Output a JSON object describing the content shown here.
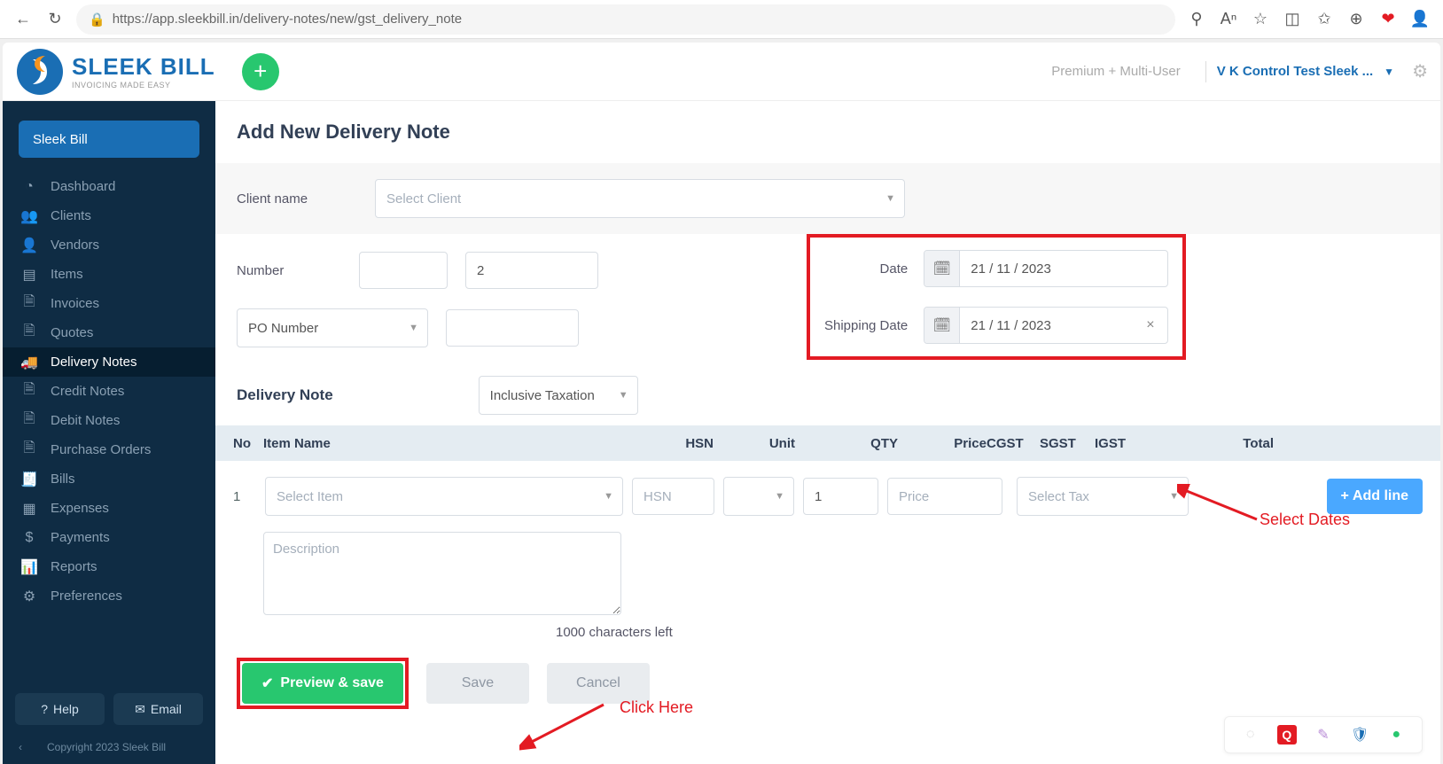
{
  "browser": {
    "url": "https://app.sleekbill.in/delivery-notes/new/gst_delivery_note"
  },
  "header": {
    "logo_title": "SLEEK BILL",
    "logo_sub": "INVOICING MADE EASY",
    "premium": "Premium + Multi-User",
    "username": "V K Control Test Sleek ..."
  },
  "sidebar": {
    "brand": "Sleek Bill",
    "items": [
      {
        "label": "Dashboard"
      },
      {
        "label": "Clients"
      },
      {
        "label": "Vendors"
      },
      {
        "label": "Items"
      },
      {
        "label": "Invoices"
      },
      {
        "label": "Quotes"
      },
      {
        "label": "Delivery Notes",
        "active": true
      },
      {
        "label": "Credit Notes"
      },
      {
        "label": "Debit Notes"
      },
      {
        "label": "Purchase Orders"
      },
      {
        "label": "Bills"
      },
      {
        "label": "Expenses"
      },
      {
        "label": "Payments"
      },
      {
        "label": "Reports"
      },
      {
        "label": "Preferences"
      }
    ],
    "help": "Help",
    "email": "Email",
    "copyright": "Copyright 2023 Sleek Bill"
  },
  "page": {
    "title": "Add New Delivery Note",
    "client_label": "Client name",
    "client_placeholder": "Select Client",
    "number_label": "Number",
    "number_prefix": "",
    "number_value": "2",
    "po_label": "PO Number",
    "date_label": "Date",
    "date_value": "21 / 11 / 2023",
    "ship_label": "Shipping Date",
    "ship_value": "21 / 11 / 2023",
    "section_title": "Delivery Note",
    "taxation": "Inclusive Taxation",
    "cols": {
      "no": "No",
      "item": "Item Name",
      "hsn": "HSN",
      "unit": "Unit",
      "qty": "QTY",
      "price": "Price",
      "cgst": "CGST",
      "sgst": "SGST",
      "igst": "IGST",
      "total": "Total"
    },
    "row": {
      "no": "1",
      "item_placeholder": "Select Item",
      "hsn_placeholder": "HSN",
      "qty_value": "1",
      "price_placeholder": "Price",
      "tax_placeholder": "Select Tax"
    },
    "addline": "Add line",
    "desc_placeholder": "Description",
    "char_left": "1000 characters left",
    "preview": "Preview & save",
    "save": "Save",
    "cancel": "Cancel"
  },
  "annotations": {
    "select_dates": "Select Dates",
    "click_here": "Click Here"
  }
}
